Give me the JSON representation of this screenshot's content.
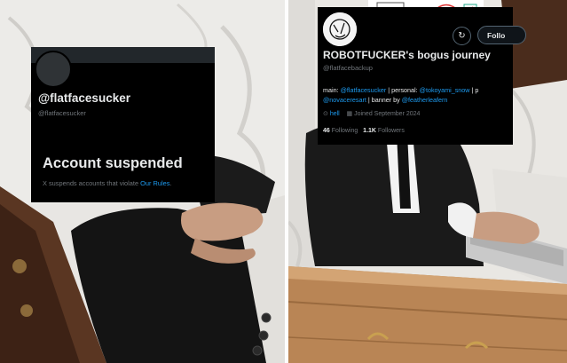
{
  "left_panel": {
    "handle": "@flatfacesucker",
    "subhandle": "@flatfacesucker",
    "suspended_title": "Account suspended",
    "suspended_text": "X suspends accounts that violate",
    "rules_link": "Our Rules",
    "rules_period": "."
  },
  "right_panel": {
    "display_name": "ROBOTFUCKER's bogus journey",
    "handle": "@flatfacebackup",
    "follow_label": "Follo",
    "refresh_glyph": "↻",
    "bio": {
      "main_prefix": "main: ",
      "main_link": "@flatfacesucker",
      "personal_prefix": " | personal: ",
      "personal_link": "@tokoyami_snow",
      "personal_suffix": " | p",
      "line2_link1": "@novaceresart",
      "line2_mid": " | banner by ",
      "line2_link2": "@featherleafern"
    },
    "location_icon": "⊙",
    "location": "hell",
    "calendar_icon": "▦",
    "joined": "Joined September 2024",
    "following_count": "46",
    "following_label": "Following",
    "followers_count": "1.1K",
    "followers_label": "Followers"
  },
  "colors": {
    "card_bg": "#000000",
    "text_primary": "#e7e9ea",
    "text_secondary": "#71767b",
    "link": "#1d9bf0"
  }
}
